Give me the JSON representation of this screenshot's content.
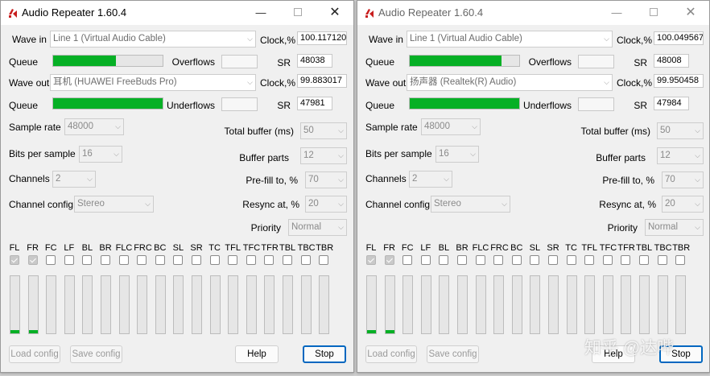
{
  "windows": [
    {
      "title": "Audio Repeater 1.60.4",
      "wave_in_label": "Wave in",
      "wave_in_value": "Line 1 (Virtual Audio Cable)",
      "clock_in_label": "Clock,%",
      "clock_in_value": "100.117120",
      "queue_in_label": "Queue",
      "queue_in_fill": 0.57,
      "overflows_label": "Overflows",
      "overflows_value": "",
      "sr_in_label": "SR",
      "sr_in_value": "48038",
      "wave_out_label": "Wave out",
      "wave_out_value": "耳机 (HUAWEI FreeBuds Pro)",
      "clock_out_label": "Clock,%",
      "clock_out_value": "99.883017",
      "queue_out_label": "Queue",
      "queue_out_fill": 1.0,
      "underflows_label": "Underflows",
      "underflows_value": "",
      "sr_out_label": "SR",
      "sr_out_value": "47981",
      "sample_rate_label": "Sample rate",
      "sample_rate_value": "48000",
      "total_buffer_label": "Total buffer (ms)",
      "total_buffer_value": "50",
      "bits_label": "Bits per sample",
      "bits_value": "16",
      "buffer_parts_label": "Buffer parts",
      "buffer_parts_value": "12",
      "channels_label": "Channels",
      "channels_value": "2",
      "prefill_label": "Pre-fill to, %",
      "prefill_value": "70",
      "channel_config_label": "Channel config",
      "channel_config_value": "Stereo",
      "resync_label": "Resync at, %",
      "resync_value": "20",
      "priority_label": "Priority",
      "priority_value": "Normal",
      "load_label": "Load config",
      "save_label": "Save config",
      "help_label": "Help",
      "stop_label": "Stop"
    },
    {
      "title": "Audio Repeater 1.60.4",
      "wave_in_label": "Wave in",
      "wave_in_value": "Line 1 (Virtual Audio Cable)",
      "clock_in_label": "Clock,%",
      "clock_in_value": "100.049567",
      "queue_in_label": "Queue",
      "queue_in_fill": 0.84,
      "overflows_label": "Overflows",
      "overflows_value": "",
      "sr_in_label": "SR",
      "sr_in_value": "48008",
      "wave_out_label": "Wave out",
      "wave_out_value": "扬声器 (Realtek(R) Audio)",
      "clock_out_label": "Clock,%",
      "clock_out_value": "99.950458",
      "queue_out_label": "Queue",
      "queue_out_fill": 1.0,
      "underflows_label": "Underflows",
      "underflows_value": "",
      "sr_out_label": "SR",
      "sr_out_value": "47984",
      "sample_rate_label": "Sample rate",
      "sample_rate_value": "48000",
      "total_buffer_label": "Total buffer (ms)",
      "total_buffer_value": "50",
      "bits_label": "Bits per sample",
      "bits_value": "16",
      "buffer_parts_label": "Buffer parts",
      "buffer_parts_value": "12",
      "channels_label": "Channels",
      "channels_value": "2",
      "prefill_label": "Pre-fill to, %",
      "prefill_value": "70",
      "channel_config_label": "Channel config",
      "channel_config_value": "Stereo",
      "resync_label": "Resync at, %",
      "resync_value": "20",
      "priority_label": "Priority",
      "priority_value": "Normal",
      "load_label": "Load config",
      "save_label": "Save config",
      "help_label": "Help",
      "stop_label": "Stop"
    }
  ],
  "channel_labels": [
    "FL",
    "FR",
    "FC",
    "LF",
    "BL",
    "BR",
    "FLC",
    "FRC",
    "BC",
    "SL",
    "SR",
    "TC",
    "TFL",
    "TFC",
    "TFR",
    "TBL",
    "TBC",
    "TBR"
  ],
  "channel_checked": [
    true,
    true,
    false,
    false,
    false,
    false,
    false,
    false,
    false,
    false,
    false,
    false,
    false,
    false,
    false,
    false,
    false,
    false
  ],
  "channel_levels": [
    0.05,
    0.05,
    0,
    0,
    0,
    0,
    0,
    0,
    0,
    0,
    0,
    0,
    0,
    0,
    0,
    0,
    0,
    0
  ],
  "watermark": "知乎 @达哔",
  "colors": {
    "meter_green": "#06b025",
    "accent": "#0067c0"
  },
  "icons": {
    "app": "speaker-icon",
    "minimize": "minimize-icon",
    "maximize": "maximize-icon",
    "close": "close-icon"
  }
}
